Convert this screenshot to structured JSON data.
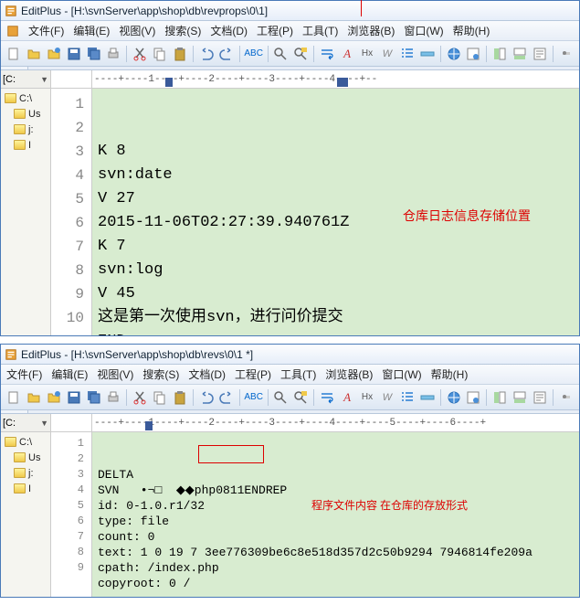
{
  "win1": {
    "title": "EditPlus - [H:\\svnServer\\app\\shop\\db\\revprops\\0\\1]",
    "annotation": "仓库日志信息存储位置",
    "lines": [
      "K 8",
      "svn:date",
      "V 27",
      "2015-11-06T02:27:39.940761Z",
      "K 7",
      "svn:log",
      "V 45",
      "这是第一次使用svn，进行问价提交",
      "END",
      ""
    ]
  },
  "win2": {
    "title": "EditPlus - [H:\\svnServer\\app\\shop\\db\\revs\\0\\1 *]",
    "annotation": "程序文件内容 在仓库的存放形式",
    "lines": [
      "DELTA",
      "SVN   •¬□  ◆◆php0811ENDREP",
      "id: 0-1.0.r1/32",
      "type: file",
      "count: 0",
      "text: 1 0 19 7 3ee776309be6c8e518d357d2c50b9294 7946814fe209a",
      "cpath: /index.php",
      "copyroot: 0 /",
      ""
    ]
  },
  "menu": {
    "file": "文件(F)",
    "edit": "编辑(E)",
    "view": "视图(V)",
    "search": "搜索(S)",
    "document": "文档(D)",
    "project": "工程(P)",
    "tools": "工具(T)",
    "browser": "浏览器(B)",
    "window": "窗口(W)",
    "help": "帮助(H)"
  },
  "drive": "[C:",
  "folders": [
    "C:\\",
    "Us",
    "j:",
    "I"
  ],
  "ruler": "----+----1----+----2----+----3----+----4----+--",
  "ruler2": "----+----1----+----2----+----3----+----4----+----5----+----6----+"
}
